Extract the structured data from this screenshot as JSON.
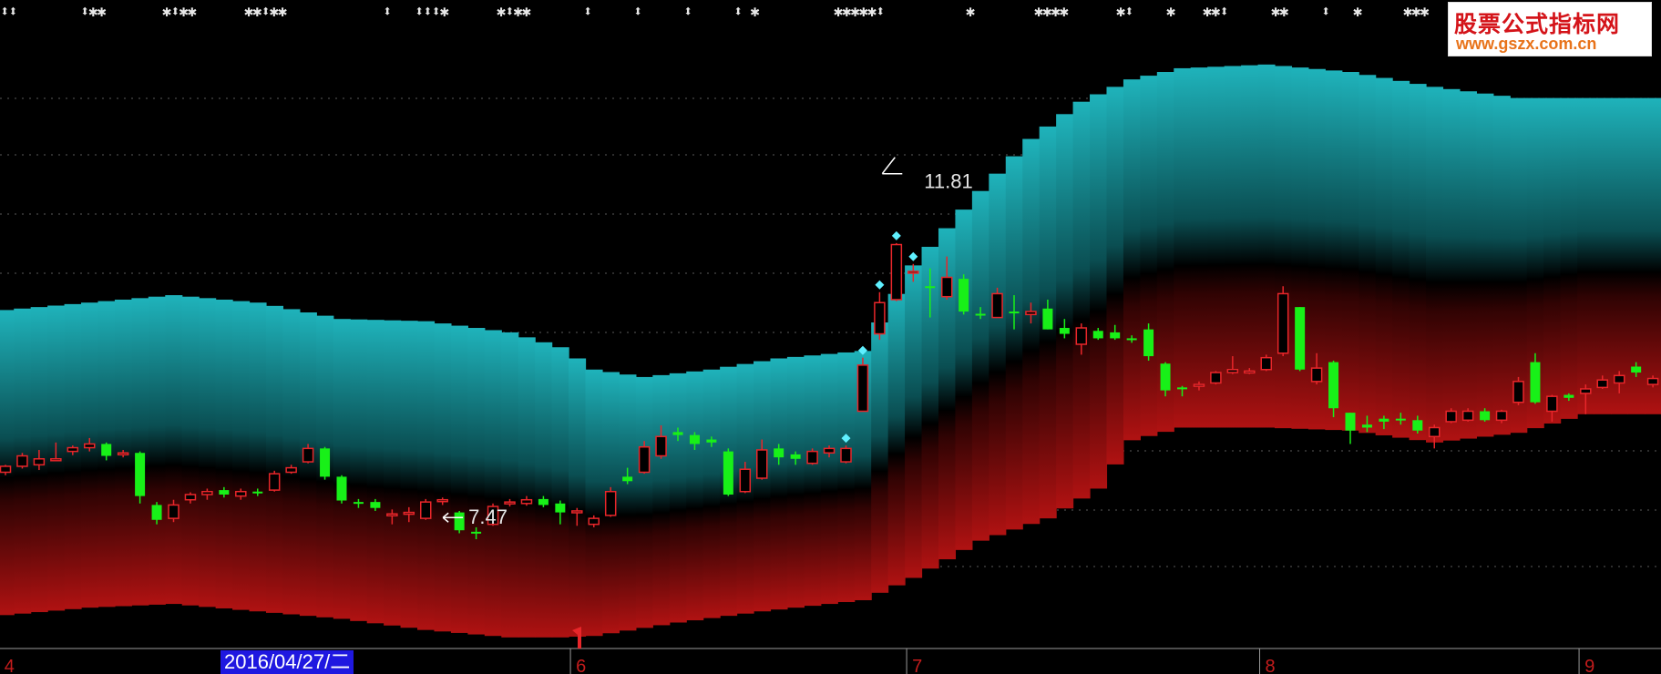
{
  "watermark": {
    "line1": "股票公式指标网",
    "line2": "www.gszx.com.cn"
  },
  "top_signals": [
    {
      "id": "sig-1",
      "text": "⬍⬍"
    },
    {
      "id": "sig-2",
      "text": "⬍✱✱"
    },
    {
      "id": "sig-3",
      "text": "✱⬍✱✱"
    },
    {
      "id": "sig-4",
      "text": "✱✱⬍✱✱"
    },
    {
      "id": "sig-5",
      "text": "⬍"
    },
    {
      "id": "sig-6",
      "text": "⬍⬍⬍✱"
    },
    {
      "id": "sig-7",
      "text": "✱⬍✱✱"
    },
    {
      "id": "sig-8",
      "text": "⬍"
    },
    {
      "id": "sig-9",
      "text": "⬍"
    },
    {
      "id": "sig-10",
      "text": "⬍"
    },
    {
      "id": "sig-11",
      "text": "⬍ ✱"
    },
    {
      "id": "sig-12",
      "text": "✱✱✱✱✱⬍"
    },
    {
      "id": "sig-13",
      "text": "✱"
    },
    {
      "id": "sig-14",
      "text": "✱✱✱✱"
    },
    {
      "id": "sig-15",
      "text": "✱⬍"
    },
    {
      "id": "sig-16",
      "text": "✱"
    },
    {
      "id": "sig-17",
      "text": "✱✱⬍"
    },
    {
      "id": "sig-18",
      "text": "✱✱"
    },
    {
      "id": "sig-19",
      "text": "⬍"
    },
    {
      "id": "sig-20",
      "text": "✱"
    },
    {
      "id": "sig-21",
      "text": "✱✱✱"
    }
  ],
  "cursor_date": "2016/04/27/二",
  "colors": {
    "bg": "#000000",
    "up": "#e8262a",
    "down": "#18f018",
    "band_top": "#1fb3bb",
    "band_bottom": "#b01212",
    "grid": "#5a5a5a",
    "axis_label": "#c41c1c",
    "diamond": "#5ff0ff",
    "text": "#e6e6e6"
  },
  "chart_data": {
    "type": "candlestick",
    "title": "",
    "xlabel": "",
    "ylabel": "",
    "ylim": [
      5.6,
      13.9
    ],
    "month_ticks": [
      {
        "label": "4",
        "index": 0
      },
      {
        "label": "6",
        "index": 34
      },
      {
        "label": "7",
        "index": 54
      },
      {
        "label": "8",
        "index": 75
      },
      {
        "label": "9",
        "index": 94
      }
    ],
    "candles": [
      [
        7.92,
        8.02,
        7.88,
        8.0
      ],
      [
        8.0,
        8.18,
        7.97,
        8.14
      ],
      [
        8.02,
        8.22,
        7.95,
        8.1
      ],
      [
        8.1,
        8.32,
        8.08,
        8.1
      ],
      [
        8.2,
        8.28,
        8.15,
        8.25
      ],
      [
        8.25,
        8.38,
        8.2,
        8.3
      ],
      [
        8.3,
        8.32,
        8.08,
        8.14
      ],
      [
        8.16,
        8.22,
        8.12,
        8.18
      ],
      [
        8.18,
        8.2,
        7.5,
        7.6
      ],
      [
        7.48,
        7.52,
        7.22,
        7.28
      ],
      [
        7.3,
        7.55,
        7.25,
        7.48
      ],
      [
        7.55,
        7.65,
        7.5,
        7.62
      ],
      [
        7.62,
        7.7,
        7.55,
        7.66
      ],
      [
        7.68,
        7.72,
        7.58,
        7.62
      ],
      [
        7.6,
        7.7,
        7.55,
        7.66
      ],
      [
        7.66,
        7.7,
        7.6,
        7.64
      ],
      [
        7.68,
        7.94,
        7.66,
        7.9
      ],
      [
        7.92,
        8.02,
        7.9,
        7.98
      ],
      [
        8.06,
        8.3,
        8.04,
        8.24
      ],
      [
        8.24,
        8.26,
        7.82,
        7.86
      ],
      [
        7.86,
        7.88,
        7.5,
        7.54
      ],
      [
        7.52,
        7.56,
        7.44,
        7.5
      ],
      [
        7.52,
        7.56,
        7.4,
        7.44
      ],
      [
        7.36,
        7.42,
        7.22,
        7.36
      ],
      [
        7.36,
        7.45,
        7.25,
        7.38
      ],
      [
        7.3,
        7.56,
        7.28,
        7.52
      ],
      [
        7.54,
        7.58,
        7.48,
        7.55
      ],
      [
        7.38,
        7.4,
        7.1,
        7.14
      ],
      [
        7.12,
        7.18,
        7.02,
        7.1
      ],
      [
        7.22,
        7.5,
        7.2,
        7.46
      ],
      [
        7.5,
        7.56,
        7.46,
        7.52
      ],
      [
        7.5,
        7.6,
        7.47,
        7.55
      ],
      [
        7.56,
        7.6,
        7.45,
        7.48
      ],
      [
        7.5,
        7.54,
        7.22,
        7.38
      ],
      [
        7.38,
        7.44,
        7.2,
        7.4
      ],
      [
        7.22,
        7.34,
        7.18,
        7.3
      ],
      [
        7.34,
        7.72,
        7.32,
        7.66
      ],
      [
        7.86,
        7.98,
        7.76,
        7.8
      ],
      [
        7.92,
        8.34,
        7.9,
        8.26
      ],
      [
        8.14,
        8.55,
        8.1,
        8.4
      ],
      [
        8.46,
        8.52,
        8.34,
        8.42
      ],
      [
        8.42,
        8.46,
        8.22,
        8.3
      ],
      [
        8.36,
        8.4,
        8.26,
        8.32
      ],
      [
        8.2,
        8.24,
        7.6,
        7.62
      ],
      [
        7.66,
        8.06,
        7.64,
        7.96
      ],
      [
        7.84,
        8.36,
        7.82,
        8.22
      ],
      [
        8.24,
        8.3,
        8.02,
        8.12
      ],
      [
        8.16,
        8.2,
        8.02,
        8.1
      ],
      [
        8.04,
        8.24,
        8.02,
        8.2
      ],
      [
        8.18,
        8.28,
        8.12,
        8.24
      ],
      [
        8.06,
        8.28,
        8.04,
        8.24
      ],
      [
        8.74,
        9.46,
        8.74,
        9.36
      ],
      [
        9.78,
        10.34,
        9.7,
        10.2
      ],
      [
        10.24,
        11.0,
        10.22,
        10.98
      ],
      [
        10.6,
        10.72,
        10.48,
        10.62
      ],
      [
        10.42,
        10.66,
        10.0,
        10.4
      ],
      [
        10.28,
        10.82,
        10.24,
        10.54
      ],
      [
        10.52,
        10.58,
        10.04,
        10.08
      ],
      [
        10.05,
        10.14,
        9.98,
        10.04
      ],
      [
        10.0,
        10.4,
        10.02,
        10.32
      ],
      [
        10.08,
        10.3,
        9.84,
        10.06
      ],
      [
        10.04,
        10.2,
        9.92,
        10.08
      ],
      [
        10.12,
        10.24,
        9.84,
        9.84
      ],
      [
        9.86,
        9.98,
        9.72,
        9.78
      ],
      [
        9.64,
        9.92,
        9.5,
        9.86
      ],
      [
        9.82,
        9.86,
        9.7,
        9.72
      ],
      [
        9.8,
        9.9,
        9.7,
        9.72
      ],
      [
        9.72,
        9.76,
        9.66,
        9.7
      ],
      [
        9.84,
        9.92,
        9.42,
        9.48
      ],
      [
        9.38,
        9.4,
        8.94,
        9.02
      ],
      [
        9.06,
        9.08,
        8.94,
        9.04
      ],
      [
        9.08,
        9.14,
        9.02,
        9.1
      ],
      [
        9.12,
        9.28,
        9.1,
        9.26
      ],
      [
        9.26,
        9.48,
        9.24,
        9.3
      ],
      [
        9.28,
        9.32,
        9.24,
        9.28
      ],
      [
        9.3,
        9.5,
        9.28,
        9.46
      ],
      [
        9.52,
        10.42,
        9.48,
        10.32
      ],
      [
        10.14,
        10.14,
        9.28,
        9.3
      ],
      [
        9.14,
        9.52,
        9.1,
        9.32
      ],
      [
        9.4,
        9.42,
        8.66,
        8.78
      ],
      [
        8.72,
        8.72,
        8.3,
        8.48
      ],
      [
        8.56,
        8.68,
        8.46,
        8.52
      ],
      [
        8.64,
        8.68,
        8.5,
        8.6
      ],
      [
        8.64,
        8.72,
        8.56,
        8.62
      ],
      [
        8.62,
        8.68,
        8.44,
        8.48
      ],
      [
        8.4,
        8.56,
        8.24,
        8.52
      ],
      [
        8.6,
        8.78,
        8.58,
        8.74
      ],
      [
        8.62,
        8.78,
        8.6,
        8.74
      ],
      [
        8.74,
        8.78,
        8.6,
        8.62
      ],
      [
        8.62,
        8.76,
        8.58,
        8.74
      ],
      [
        8.86,
        9.2,
        8.82,
        9.14
      ],
      [
        9.4,
        9.52,
        8.84,
        8.86
      ],
      [
        8.74,
        8.96,
        8.6,
        8.94
      ],
      [
        8.96,
        8.98,
        8.88,
        8.92
      ],
      [
        8.98,
        9.1,
        8.7,
        9.04
      ],
      [
        9.06,
        9.22,
        9.04,
        9.16
      ],
      [
        9.12,
        9.28,
        8.98,
        9.22
      ],
      [
        9.34,
        9.4,
        9.2,
        9.26
      ],
      [
        9.1,
        9.22,
        9.06,
        9.18
      ],
      [
        9.14,
        9.5,
        9.12,
        9.34
      ],
      [
        9.34,
        9.42,
        9.18,
        9.22
      ],
      [
        9.26,
        9.38,
        9.18,
        9.24
      ]
    ],
    "upper_band": [
      [
        0,
        10.1
      ],
      [
        5,
        10.2
      ],
      [
        10,
        10.3
      ],
      [
        15,
        10.2
      ],
      [
        20,
        9.98
      ],
      [
        25,
        9.95
      ],
      [
        30,
        9.8
      ],
      [
        33,
        9.6
      ],
      [
        35,
        9.3
      ],
      [
        38,
        9.2
      ],
      [
        42,
        9.3
      ],
      [
        46,
        9.45
      ],
      [
        51,
        9.55
      ],
      [
        54,
        10.7
      ],
      [
        58,
        11.7
      ],
      [
        61,
        12.4
      ],
      [
        64,
        12.9
      ],
      [
        67,
        13.2
      ],
      [
        70,
        13.35
      ],
      [
        75,
        13.4
      ],
      [
        80,
        13.3
      ],
      [
        85,
        13.1
      ],
      [
        90,
        12.95
      ],
      [
        94,
        12.95
      ]
    ],
    "lower_band": [
      [
        0,
        6.0
      ],
      [
        5,
        6.1
      ],
      [
        10,
        6.15
      ],
      [
        15,
        6.05
      ],
      [
        20,
        5.95
      ],
      [
        25,
        5.8
      ],
      [
        30,
        5.7
      ],
      [
        33,
        5.7
      ],
      [
        35,
        5.72
      ],
      [
        40,
        5.9
      ],
      [
        45,
        6.05
      ],
      [
        51,
        6.2
      ],
      [
        54,
        6.5
      ],
      [
        58,
        7.0
      ],
      [
        62,
        7.3
      ],
      [
        65,
        7.7
      ],
      [
        67,
        8.35
      ],
      [
        70,
        8.52
      ],
      [
        75,
        8.52
      ],
      [
        80,
        8.48
      ],
      [
        85,
        8.32
      ],
      [
        90,
        8.45
      ],
      [
        94,
        8.7
      ]
    ],
    "signal_diamonds": [
      50,
      51,
      52,
      53,
      54
    ],
    "annotations": [
      {
        "type": "high",
        "value_text": "11.81",
        "index": 54,
        "value": 11.81
      },
      {
        "type": "low",
        "value_text": "7.47",
        "index": 27,
        "value": 7.47
      }
    ]
  }
}
